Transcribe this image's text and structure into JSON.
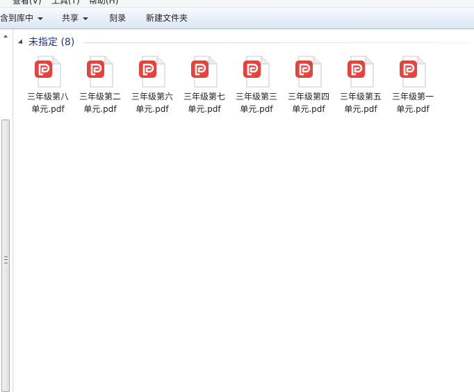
{
  "menubar": {
    "items": [
      "查看(V)",
      "工具(T)",
      "帮助(H)"
    ]
  },
  "toolbar": {
    "include_in_library": "含到库中",
    "share": "共享",
    "burn": "刻录",
    "new_folder": "新建文件夹"
  },
  "group": {
    "title": "未指定 (8)"
  },
  "files": [
    {
      "line1": "三年级第八",
      "line2": "单元.pdf"
    },
    {
      "line1": "三年级第二",
      "line2": "单元.pdf"
    },
    {
      "line1": "三年级第六",
      "line2": "单元.pdf"
    },
    {
      "line1": "三年级第七",
      "line2": "单元.pdf"
    },
    {
      "line1": "三年级第三",
      "line2": "单元.pdf"
    },
    {
      "line1": "三年级第四",
      "line2": "单元.pdf"
    },
    {
      "line1": "三年级第五",
      "line2": "单元.pdf"
    },
    {
      "line1": "三年级第一",
      "line2": "单元.pdf"
    }
  ],
  "colors": {
    "pdf_badge": "#e5433e",
    "group_title": "#1e3287"
  },
  "icons": {
    "file": "pdf-file-icon",
    "toggle": "collapse-triangle-icon"
  }
}
